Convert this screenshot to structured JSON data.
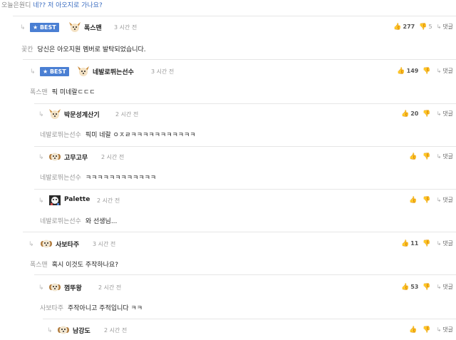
{
  "top": {
    "prefix": "오늘은원디",
    "link": "네?? 저 아오지로 가나요?"
  },
  "labels": {
    "best": "★ BEST",
    "reply": "댓글",
    "arrow": "↳",
    "thumb_up": "👍",
    "thumb_down": "👎"
  },
  "comments": [
    {
      "author": "폭스맨",
      "time": "3 시간 전",
      "best": true,
      "up": "277",
      "down": "5",
      "to": "꽃칸",
      "text": "당신은 아오지원 멤버로 발탁되었습니다.",
      "avatar": "dog-avatar"
    },
    {
      "author": "네발로뛰는선수",
      "time": "3 시간 전",
      "best": true,
      "up": "149",
      "down": "",
      "to": "폭스맨",
      "text": "픽 미네랄ㄷㄷㄷ",
      "avatar": "dog-avatar"
    },
    {
      "author": "박문성계산기",
      "time": "2 시간 전",
      "best": false,
      "up": "20",
      "down": "",
      "to": "네발로뛰는선수",
      "text": "픽미 네랄 ㅇㅈㄹㅋㅋㅋㅋㅋㅋㅋㅋㅋㅋㅋ",
      "avatar": "dog-avatar"
    },
    {
      "author": "고무고무",
      "time": "2 시간 전",
      "best": false,
      "up": "",
      "down": "",
      "to": "네발로뛰는선수",
      "text": "ㅋㅋㅋㅋㅋㅋㅋㅋㅋㅋㅋㅋ",
      "avatar": "puppy-avatar"
    },
    {
      "author": "Palette",
      "time": "2 시간 전",
      "best": false,
      "up": "",
      "down": "",
      "to": "네발로뛰는선수",
      "text": "와 선생님...",
      "avatar": "palette-avatar"
    },
    {
      "author": "사보타주",
      "time": "3 시간 전",
      "best": false,
      "up": "11",
      "down": "",
      "to": "폭스맨",
      "text": "혹시 이것도 주작하나요?",
      "avatar": "puppy-avatar"
    },
    {
      "author": "껌뚜왕",
      "time": "2 시간 전",
      "best": false,
      "up": "53",
      "down": "",
      "to": "사보타주",
      "text": "주작아니고 주적입니다 ㅋㅋ",
      "avatar": "puppy-avatar"
    },
    {
      "author": "남강도",
      "time": "2 시간 전",
      "best": false,
      "up": "",
      "down": "",
      "to": "",
      "text": "",
      "avatar": "puppy-avatar"
    }
  ]
}
